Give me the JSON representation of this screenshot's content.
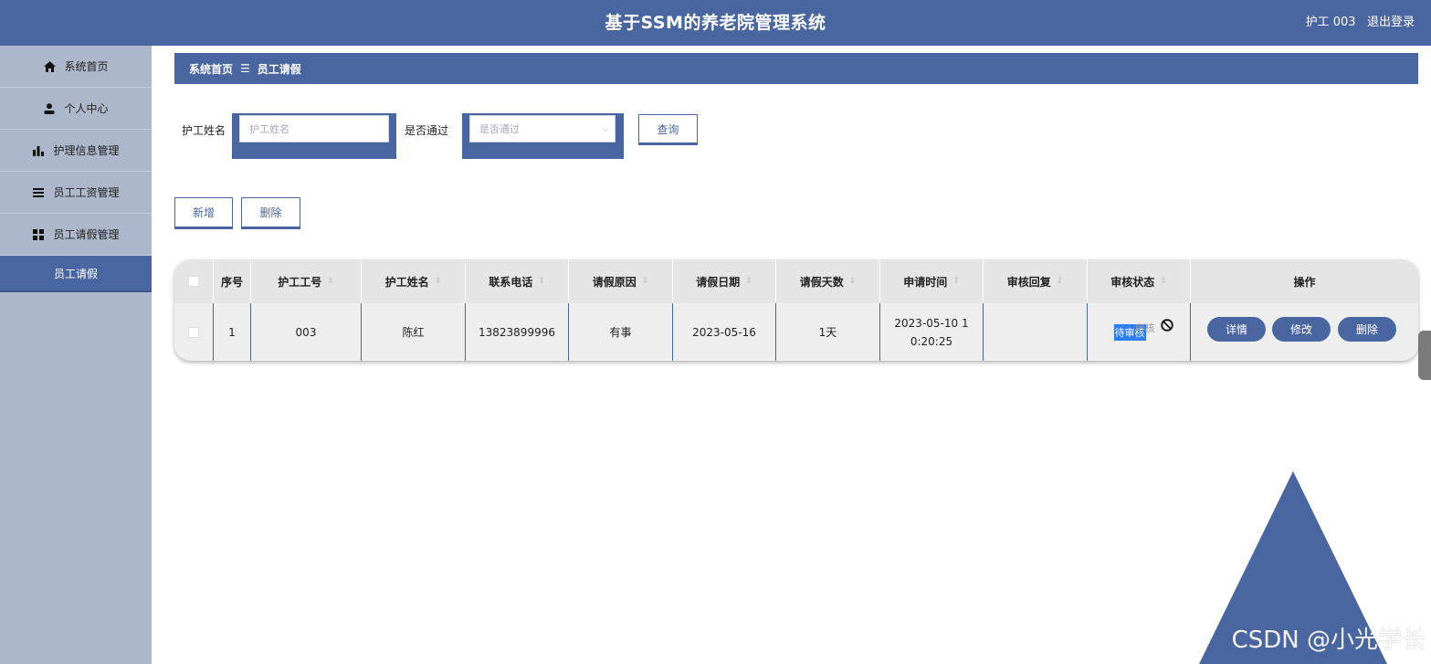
{
  "header": {
    "title": "基于SSM的养老院管理系统",
    "user": "护工 003",
    "logout": "退出登录"
  },
  "sidebar": {
    "items": [
      {
        "label": "系统首页",
        "icon": "home-icon"
      },
      {
        "label": "个人中心",
        "icon": "user-icon"
      },
      {
        "label": "护理信息管理",
        "icon": "bar-chart-icon"
      },
      {
        "label": "员工工资管理",
        "icon": "list-icon"
      },
      {
        "label": "员工请假管理",
        "icon": "grid-icon"
      },
      {
        "label": "员工请假",
        "icon": ""
      }
    ]
  },
  "breadcrumb": {
    "home": "系统首页",
    "separator": "☰",
    "current": "员工请假"
  },
  "search": {
    "name_label": "护工姓名",
    "name_placeholder": "护工姓名",
    "pass_label": "是否通过",
    "pass_placeholder": "是否通过",
    "query_button": "查询"
  },
  "actions": {
    "add": "新增",
    "delete": "删除"
  },
  "table": {
    "headers": [
      "序号",
      "护工工号",
      "护工姓名",
      "联系电话",
      "请假原因",
      "请假日期",
      "请假天数",
      "申请时间",
      "审核回复",
      "审核状态",
      "操作"
    ],
    "rows": [
      {
        "index": "1",
        "nurse_id": "003",
        "nurse_name": "陈红",
        "phone": "13823899996",
        "reason": "有事",
        "date": "2023-05-16",
        "days": "1天",
        "apply_time": "2023-05-10 10:20:25",
        "reply": "",
        "status": "待审核",
        "status_ghost": "审核",
        "ops": [
          "详情",
          "修改",
          "删除"
        ]
      }
    ]
  },
  "watermark": "CSDN @小光学长",
  "colors": {
    "primary": "#4a66a0",
    "sidebar": "#adb7cc"
  }
}
